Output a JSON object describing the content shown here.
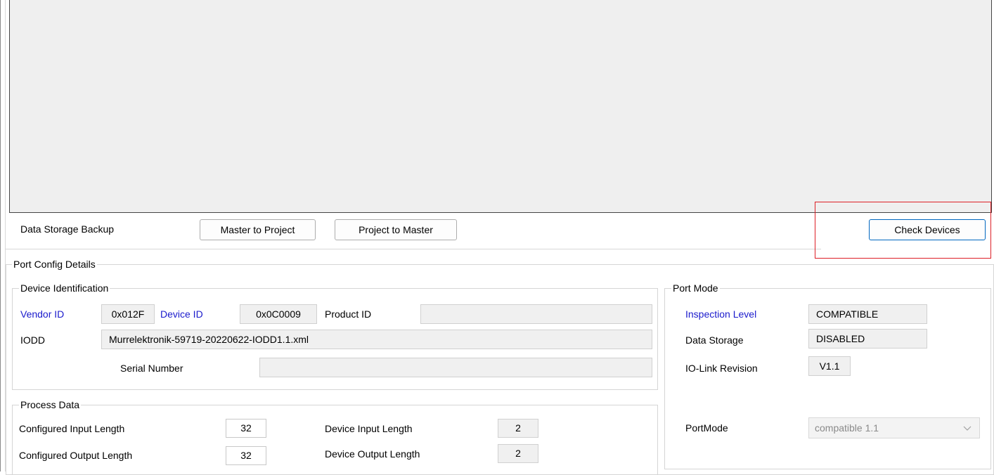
{
  "backup": {
    "label": "Data Storage Backup",
    "master_to_project": "Master to Project",
    "project_to_master": "Project to Master",
    "check_devices": "Check Devices"
  },
  "port_config": {
    "title": "Port Config Details",
    "device_identification": {
      "title": "Device Identification",
      "vendor_id_label": "Vendor ID",
      "vendor_id_value": "0x012F",
      "device_id_label": "Device ID",
      "device_id_value": "0x0C0009",
      "product_id_label": "Product ID",
      "product_id_value": "",
      "iodd_label": "IODD",
      "iodd_value": "Murrelektronik-59719-20220622-IODD1.1.xml",
      "serial_label": "Serial Number",
      "serial_value": ""
    },
    "process_data": {
      "title": "Process Data",
      "cfg_input_label": "Configured Input Length",
      "cfg_input_value": "32",
      "cfg_output_label": "Configured Output Length",
      "cfg_output_value": "32",
      "dev_input_label": "Device Input Length",
      "dev_input_value": "2",
      "dev_output_label": "Device Output Length",
      "dev_output_value": "2"
    },
    "port_mode": {
      "title": "Port Mode",
      "inspection_label": "Inspection Level",
      "inspection_value": "COMPATIBLE",
      "data_storage_label": "Data Storage",
      "data_storage_value": "DISABLED",
      "revision_label": "IO-Link Revision",
      "revision_value": "V1.1",
      "portmode_label": "PortMode",
      "portmode_value": "compatible 1.1"
    }
  },
  "colors": {
    "label_blue": "#1a1acc",
    "highlight_red": "#dd1f26",
    "panel_gray": "#efefef"
  }
}
